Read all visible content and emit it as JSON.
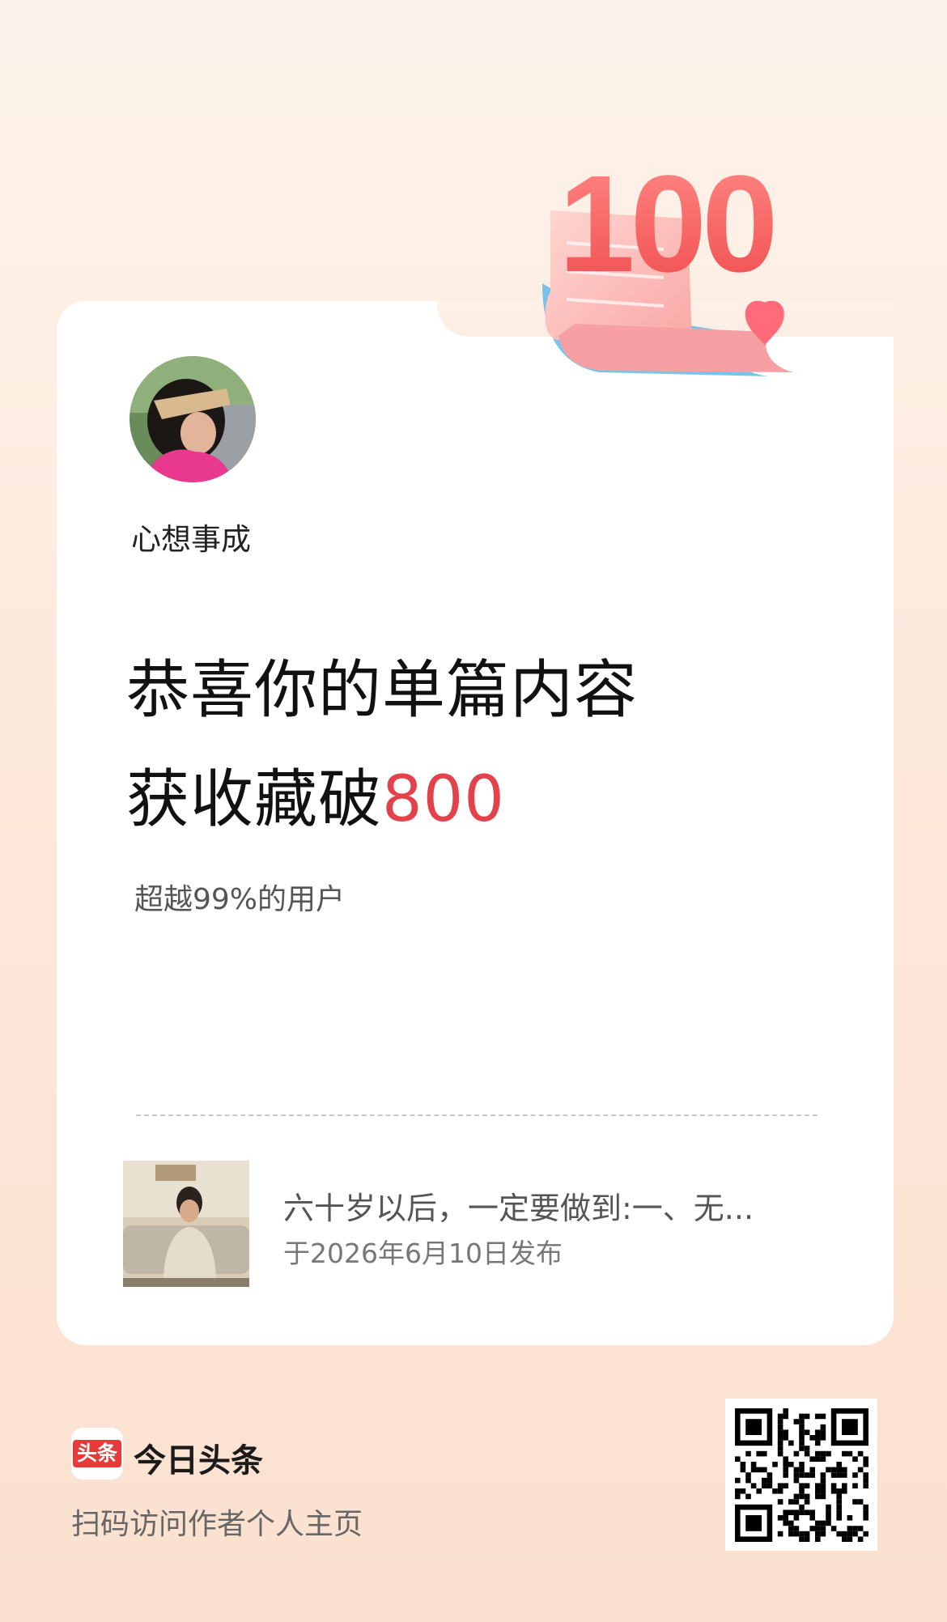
{
  "badge": {
    "number": "100"
  },
  "author": {
    "name": "心想事成"
  },
  "headline": {
    "line1": "恭喜你的单篇内容",
    "line2_prefix": "获收藏破",
    "line2_number": "800"
  },
  "percentile_text": "超越99%的用户",
  "article": {
    "title": "六十岁以后，一定要做到:一、无...",
    "date": "于2026年6月10日发布"
  },
  "footer": {
    "logo_text": "头条",
    "brand": "今日头条",
    "hint": "扫码访问作者个人主页"
  },
  "colors": {
    "accent_red": "#e3424b",
    "logo_red": "#e93a3a"
  },
  "icons": [
    "heart-icon",
    "qr-code",
    "toutiao-logo-icon"
  ]
}
